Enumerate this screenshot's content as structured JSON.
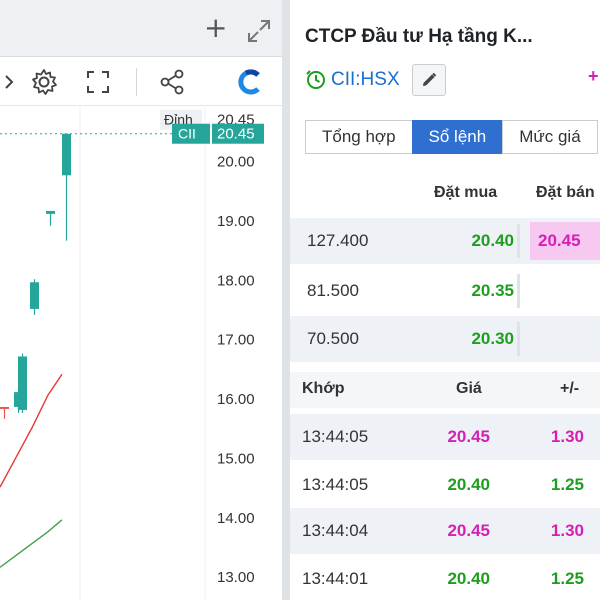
{
  "chart_panel": {
    "plus_label": "+",
    "price_axis": [
      "20.00",
      "19.00",
      "18.00",
      "17.00",
      "16.00",
      "15.00",
      "14.00",
      "13.00"
    ],
    "peak_label": "Đỉnh",
    "peak_value": "20.45",
    "symbol_tag": "CII",
    "last_value": "20.45",
    "colors": {
      "up": "#26a69a",
      "down": "#ef5350",
      "ma_red": "#e53935",
      "ma_green": "#43a047",
      "tag_bg": "#26a69a"
    }
  },
  "chart_data": {
    "type": "candlestick",
    "ticker": "CII",
    "ylim": [
      12.6,
      20.9
    ],
    "y_ticks": [
      13.0,
      14.0,
      15.0,
      16.0,
      17.0,
      18.0,
      19.0,
      20.0
    ],
    "candles": [
      {
        "open": 15.85,
        "close": 15.82,
        "high": 15.85,
        "low": 15.65,
        "dir": "down"
      },
      {
        "open": 15.85,
        "close": 16.1,
        "high": 16.15,
        "low": 15.75,
        "dir": "up"
      },
      {
        "open": 15.8,
        "close": 16.7,
        "high": 16.75,
        "low": 15.75,
        "dir": "up"
      },
      {
        "open": 17.5,
        "close": 17.95,
        "high": 18.0,
        "low": 17.4,
        "dir": "up"
      },
      {
        "open": 19.1,
        "close": 19.15,
        "high": 19.15,
        "low": 18.9,
        "dir": "up"
      },
      {
        "open": 19.75,
        "close": 20.45,
        "high": 20.45,
        "low": 18.65,
        "dir": "up"
      }
    ],
    "ma_red": [
      14.5,
      15.0,
      15.5,
      16.05,
      16.4
    ],
    "ma_green": [
      13.15,
      13.35,
      13.55,
      13.75,
      13.95
    ],
    "last_price": 20.45,
    "peak": 20.45
  },
  "stock": {
    "company_name": "CTCP Đầu tư Hạ tầng K...",
    "ticker": "CII:HSX",
    "tabs": [
      {
        "label": "Tổng hợp",
        "active": false
      },
      {
        "label": "Sổ lệnh",
        "active": true
      },
      {
        "label": "Mức giá",
        "active": false
      }
    ]
  },
  "orderbook": {
    "header_buy": "Đặt mua",
    "header_sell": "Đặt bán",
    "rows": [
      {
        "volume": "127.400",
        "buy": "20.40",
        "sell": "20.45"
      },
      {
        "volume": "81.500",
        "buy": "20.35",
        "sell": ""
      },
      {
        "volume": "70.500",
        "buy": "20.30",
        "sell": ""
      }
    ]
  },
  "matches": {
    "header_time": "Khớp",
    "header_price": "Giá",
    "header_change": "+/-",
    "rows": [
      {
        "time": "13:44:05",
        "price": "20.45",
        "change": "1.30",
        "color": "pink"
      },
      {
        "time": "13:44:05",
        "price": "20.40",
        "change": "1.25",
        "color": "green"
      },
      {
        "time": "13:44:04",
        "price": "20.45",
        "change": "1.30",
        "color": "pink"
      },
      {
        "time": "13:44:01",
        "price": "20.40",
        "change": "1.25",
        "color": "green"
      }
    ]
  }
}
